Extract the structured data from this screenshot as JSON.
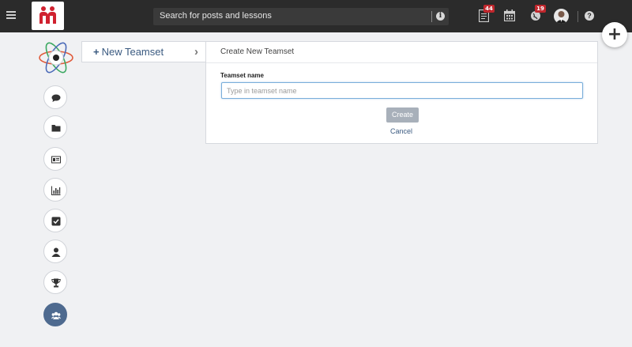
{
  "topbar": {
    "search_placeholder": "Search for posts and lessons",
    "info_icon": "i",
    "notifications_badge": "44",
    "messages_badge": "19",
    "help_icon": "?",
    "add_icon": "+"
  },
  "breadcrumb": {
    "icon": "+",
    "label": "New Teamset"
  },
  "form": {
    "title": "Create New Teamset",
    "field_label": "Teamset name",
    "field_placeholder": "Type in teamset name",
    "field_value": "",
    "create_label": "Create",
    "cancel_label": "Cancel"
  },
  "sidebar": {
    "items": [
      {
        "icon": "comment-icon"
      },
      {
        "icon": "folder-icon"
      },
      {
        "icon": "id-card-icon"
      },
      {
        "icon": "bar-chart-icon"
      },
      {
        "icon": "check-square-icon"
      },
      {
        "icon": "user-icon"
      },
      {
        "icon": "trophy-icon"
      },
      {
        "icon": "users-icon",
        "active": true
      }
    ]
  },
  "colors": {
    "topbar_bg": "#2b2b2b",
    "accent": "#4e6a8f",
    "link": "#3a5a80",
    "badge": "#c0272d",
    "create_button": "#a8b0ba",
    "logo_red": "#d0212f"
  }
}
